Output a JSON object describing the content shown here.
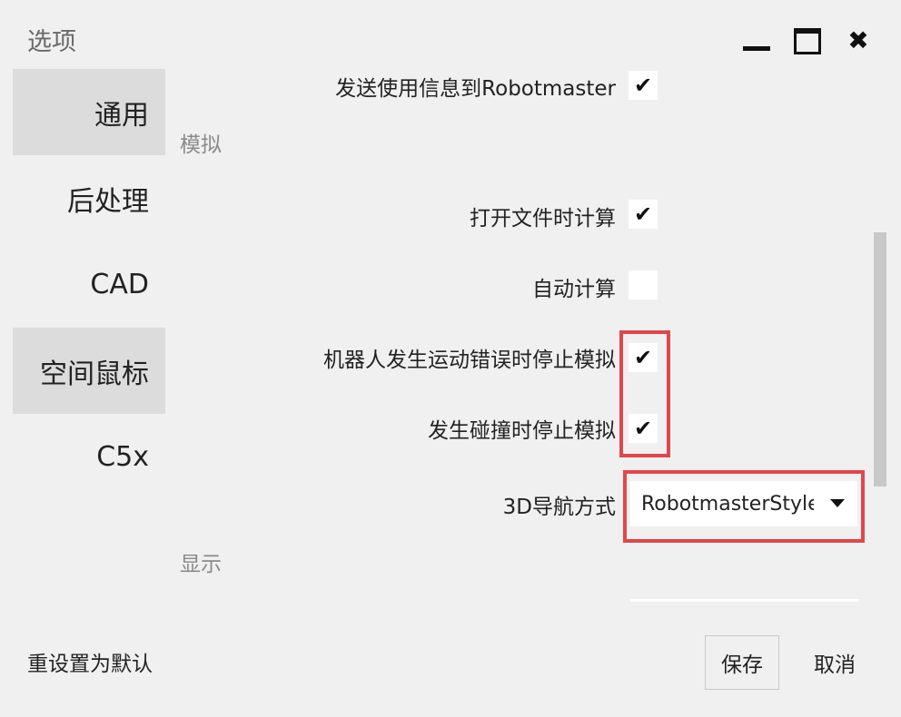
{
  "window": {
    "title": "选项",
    "controls": {
      "minimize_icon": "minimize-icon",
      "maximize_icon": "maximize-icon",
      "close_icon": "close-icon",
      "close_glyph": "✖"
    }
  },
  "sidebar": {
    "items": [
      {
        "label": "通用",
        "active": true
      },
      {
        "label": "后处理",
        "active": false
      },
      {
        "label": "CAD",
        "active": false
      },
      {
        "label": "空间鼠标",
        "active": true
      },
      {
        "label": "C5x",
        "active": false
      }
    ]
  },
  "general": {
    "send_usage_label": "发送使用信息到Robotmaster",
    "send_usage_checked": true
  },
  "simulation": {
    "section_label": "模拟",
    "calc_on_open_label": "打开文件时计算",
    "calc_on_open_checked": true,
    "auto_calc_label": "自动计算",
    "auto_calc_checked": false,
    "stop_on_motion_error_label": "机器人发生运动错误时停止模拟",
    "stop_on_motion_error_checked": true,
    "stop_on_collision_label": "发生碰撞时停止模拟",
    "stop_on_collision_checked": true,
    "nav_mode_label": "3D导航方式",
    "nav_mode_value": "RobotmasterStyle"
  },
  "display": {
    "section_label": "显示"
  },
  "footer": {
    "reset_label": "重设置为默认",
    "save_label": "保存",
    "cancel_label": "取消"
  },
  "colors": {
    "background": "#f0f0f0",
    "highlight": "#e0474c",
    "active_nav": "#dcdcdc"
  },
  "check_glyph": "✔"
}
